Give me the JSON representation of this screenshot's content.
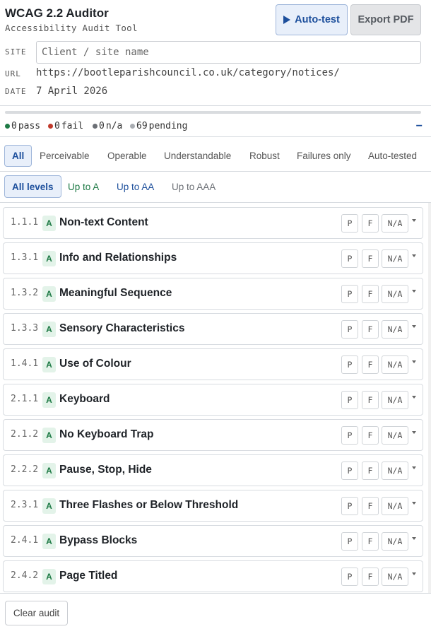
{
  "app": {
    "title": "WCAG 2.2 Auditor",
    "subtitle": "Accessibility Audit Tool"
  },
  "toolbar": {
    "auto_test_label": "Auto-test",
    "export_label": "Export PDF"
  },
  "meta": {
    "site_label": "SITE",
    "site_placeholder": "Client / site name",
    "site_value": "",
    "url_label": "URL",
    "url_value": "https://bootleparishcouncil.co.uk/category/notices/",
    "date_label": "DATE",
    "date_value": "7 April 2026"
  },
  "progress": {
    "fraction": 0
  },
  "stats": {
    "pass_count": "0",
    "pass_label": "pass",
    "fail_count": "0",
    "fail_label": "fail",
    "na_count": "0",
    "na_label": "n/a",
    "pending_count": "69",
    "pending_label": "pending",
    "collapse_label": "−",
    "colors": {
      "pass": "#1e7a45",
      "fail": "#c0392b",
      "na": "#6b6f75",
      "pending": "#a9adb2"
    }
  },
  "principle_tabs": [
    {
      "label": "All",
      "active": true
    },
    {
      "label": "Perceivable",
      "active": false
    },
    {
      "label": "Operable",
      "active": false
    },
    {
      "label": "Understandable",
      "active": false
    },
    {
      "label": "Robust",
      "active": false
    },
    {
      "label": "Failures only",
      "active": false
    },
    {
      "label": "Auto-tested",
      "active": false
    }
  ],
  "level_tabs": [
    {
      "label": "All levels",
      "active": true,
      "color": "#1d4f9c"
    },
    {
      "label": "Up to A",
      "active": false,
      "color": "#1e7a45"
    },
    {
      "label": "Up to AA",
      "active": false,
      "color": "#1d4f9c"
    },
    {
      "label": "Up to AAA",
      "active": false,
      "color": "#6b6f75"
    }
  ],
  "criteria": [
    {
      "num": "1.1.1",
      "level": "A",
      "name": "Non-text Content"
    },
    {
      "num": "1.3.1",
      "level": "A",
      "name": "Info and Relationships"
    },
    {
      "num": "1.3.2",
      "level": "A",
      "name": "Meaningful Sequence"
    },
    {
      "num": "1.3.3",
      "level": "A",
      "name": "Sensory Characteristics"
    },
    {
      "num": "1.4.1",
      "level": "A",
      "name": "Use of Colour"
    },
    {
      "num": "2.1.1",
      "level": "A",
      "name": "Keyboard"
    },
    {
      "num": "2.1.2",
      "level": "A",
      "name": "No Keyboard Trap"
    },
    {
      "num": "2.2.2",
      "level": "A",
      "name": "Pause, Stop, Hide"
    },
    {
      "num": "2.3.1",
      "level": "A",
      "name": "Three Flashes or Below Threshold"
    },
    {
      "num": "2.4.1",
      "level": "A",
      "name": "Bypass Blocks"
    },
    {
      "num": "2.4.2",
      "level": "A",
      "name": "Page Titled"
    }
  ],
  "row_buttons": {
    "pass": "P",
    "fail": "F",
    "na": "N/A"
  },
  "footer": {
    "clear_label": "Clear audit"
  }
}
